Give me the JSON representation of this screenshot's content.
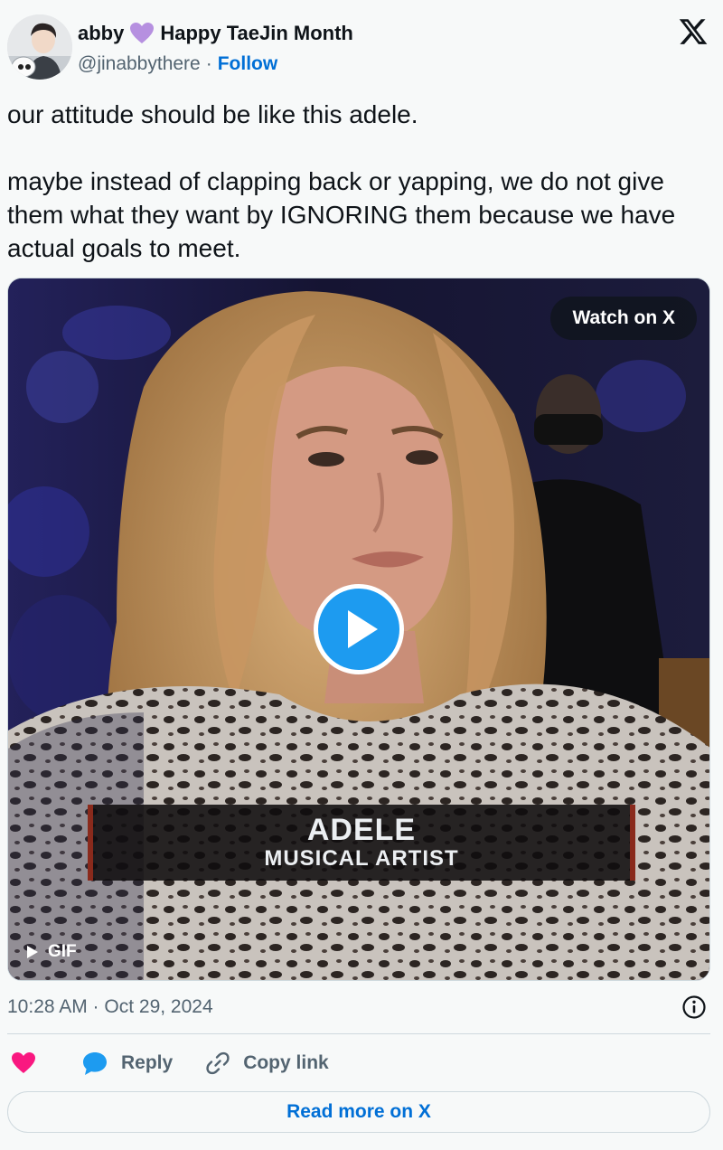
{
  "author": {
    "display_name": "abby",
    "name_suffix": "Happy TaeJin Month",
    "name_emoji": "purple-heart-icon",
    "handle": "@jinabbythere",
    "separator": "·",
    "follow_label": "Follow"
  },
  "tweet": {
    "paragraphs": [
      "our attitude should be like this adele.",
      "maybe instead of clapping back or yapping, we do not give them what they want by IGNORING them because we have actual goals to meet."
    ],
    "timestamp": "10:28 AM · Oct 29, 2024"
  },
  "media": {
    "watch_label": "Watch on X",
    "gif_label": "GIF",
    "caption_name": "ADELE",
    "caption_role": "MUSICAL ARTIST"
  },
  "actions": {
    "reply_label": "Reply",
    "copy_link_label": "Copy link"
  },
  "read_more_label": "Read more on X",
  "colors": {
    "accent": "#1d9bf0",
    "link": "#006fd6",
    "like": "#f91880",
    "purple_heart": "#b690e0",
    "secondary_text": "#536471"
  }
}
